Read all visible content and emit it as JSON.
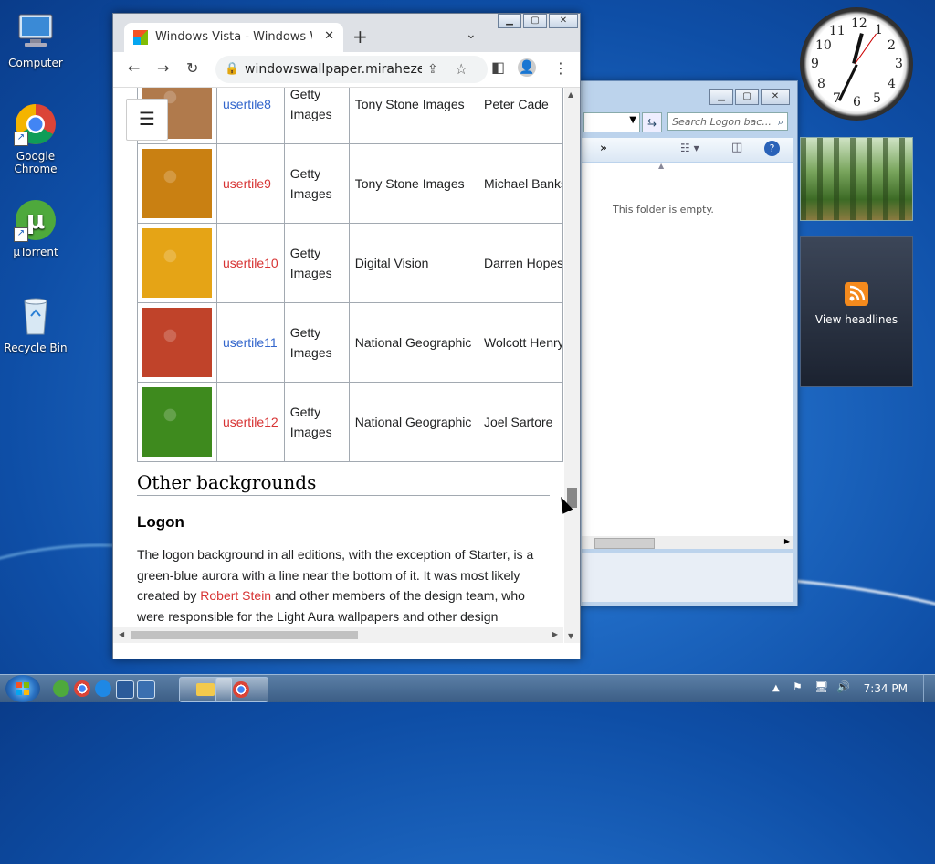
{
  "desktop": {
    "icons": [
      {
        "label": "Computer"
      },
      {
        "label": "Google Chrome"
      },
      {
        "label": "µTorrent"
      },
      {
        "label": "Recycle Bin"
      }
    ]
  },
  "browser": {
    "tab_title": "Windows Vista - Windows Wallpaper Wiki",
    "tab_close": "✕",
    "new_tab": "+",
    "url": "windowswallpaper.miraheze.org",
    "toc_icon": "list-icon"
  },
  "table": {
    "rows": [
      {
        "name": "usertile8",
        "link": "blue",
        "source": "Getty Images",
        "collection": "Tony Stone Images",
        "author": "Peter Cade",
        "tile_color": "#b07a4c"
      },
      {
        "name": "usertile9",
        "link": "red",
        "source": "Getty Images",
        "collection": "Tony Stone Images",
        "author": "Michael Banks",
        "tile_color": "#c98012"
      },
      {
        "name": "usertile10",
        "link": "red",
        "source": "Getty Images",
        "collection": "Digital Vision",
        "author": "Darren Hopes",
        "tile_color": "#e5a416"
      },
      {
        "name": "usertile11",
        "link": "blue",
        "source": "Getty Images",
        "collection": "National Geographic",
        "author": "Wolcott Henry",
        "tile_color": "#c0432a"
      },
      {
        "name": "usertile12",
        "link": "red",
        "source": "Getty Images",
        "collection": "National Geographic",
        "author": "Joel Sartore",
        "tile_color": "#3e8a1e"
      }
    ]
  },
  "article": {
    "h2": "Other backgrounds",
    "h3": "Logon",
    "para_before": "The logon background in all editions, with the exception of Starter, is a green-blue aurora with a line near the bottom of it. It was most likely created by ",
    "para_link": "Robert Stein",
    "para_after": " and other members of the design team, who were responsible for the Light Aura wallpapers and other design elements of Vista. It is included at many different resolutions, including"
  },
  "explorer": {
    "search_placeholder": "Search Logon bac...",
    "empty_text": "This folder is empty."
  },
  "gadgets": {
    "rss_label": "View headlines"
  },
  "taskbar": {
    "time": "7:34 PM"
  }
}
